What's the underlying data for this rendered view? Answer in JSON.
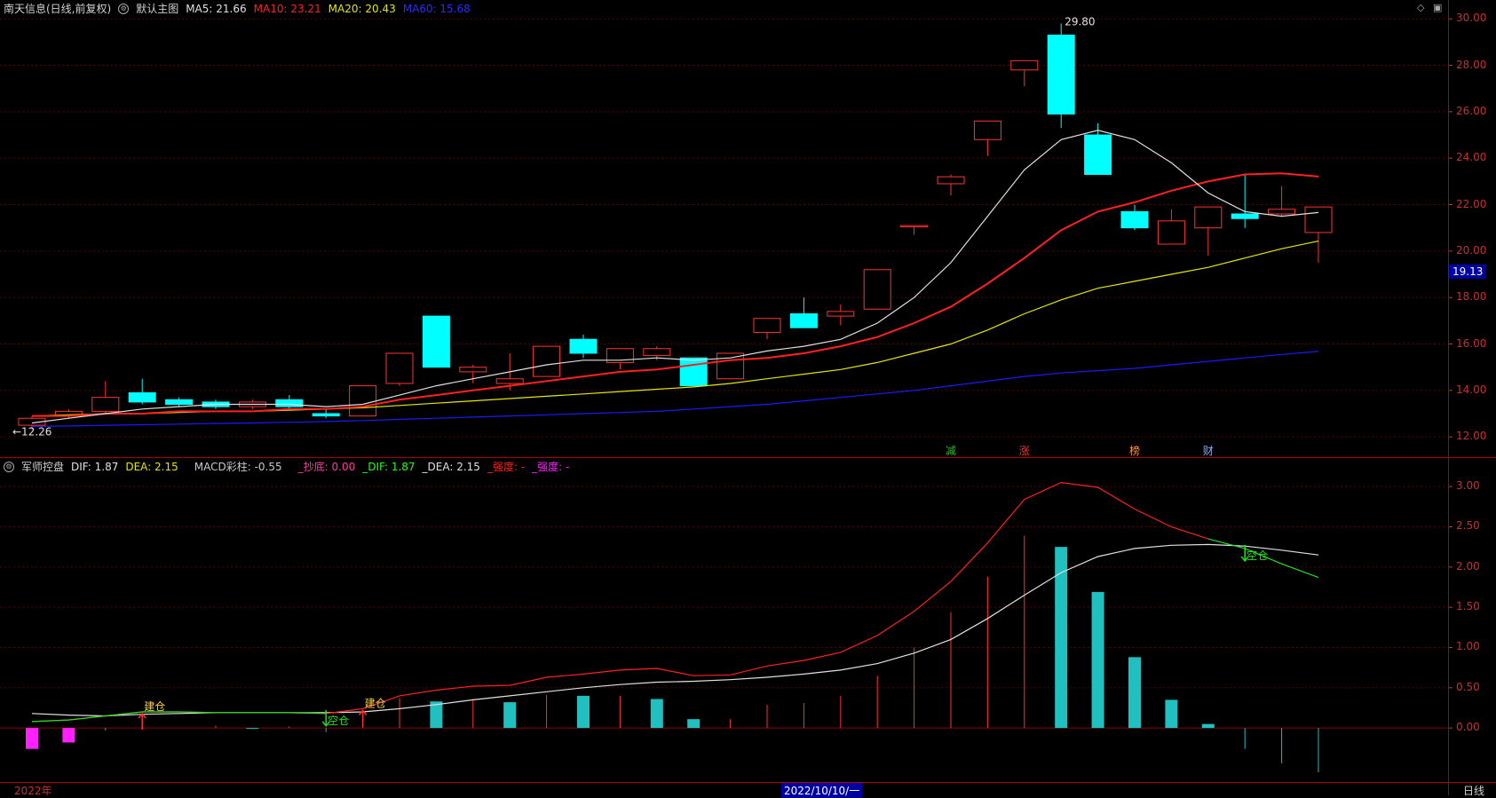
{
  "header": {
    "stock_title": "南天信息(日线,前复权)",
    "main_chart_label": "默认主图",
    "ma5": "MA5: 21.66",
    "ma10": "MA10: 23.21",
    "ma20": "MA20: 20.43",
    "ma60": "MA60: 15.68"
  },
  "sub_header": {
    "indicator_name": "军师控盘",
    "dif": "DIF: 1.87",
    "dea": "DEA: 2.15",
    "macd": "MACD彩柱: -0.55",
    "chaodi": "_抄底: 0.00",
    "dif2": "_DIF: 1.87",
    "dea2": "_DEA: 2.15",
    "qiangdu1": "_强度: -",
    "qiangdu2": "_强度: -"
  },
  "bottom": {
    "year_label": "2022年",
    "date_label": "2022/10/10/一",
    "period_label": "日线"
  },
  "price_tag": "19.13",
  "colors": {
    "up": "#ff3232",
    "down": "#00ffff",
    "ma5": "#e0e0e0",
    "ma10": "#ff2020",
    "ma20": "#e6e600",
    "ma60": "#1a1aff",
    "axis": "#c83030",
    "grid": "#5a0000"
  },
  "chart_data": [
    {
      "type": "candlestick",
      "ylim": [
        11.7,
        30.2
      ],
      "yticks": [
        12.0,
        14.0,
        16.0,
        18.0,
        20.0,
        22.0,
        24.0,
        26.0,
        28.0,
        30.0
      ],
      "ytick_labels": [
        "12.00",
        "14.00",
        "16.00",
        "18.00",
        "20.00",
        "22.00",
        "24.00",
        "26.00",
        "28.00",
        "30.00"
      ],
      "candles": [
        {
          "o": 12.5,
          "h": 12.9,
          "l": 12.3,
          "c": 12.8
        },
        {
          "o": 12.9,
          "h": 13.2,
          "l": 12.8,
          "c": 13.1
        },
        {
          "o": 13.1,
          "h": 14.4,
          "l": 13.0,
          "c": 13.7
        },
        {
          "o": 13.9,
          "h": 14.5,
          "l": 13.4,
          "c": 13.5
        },
        {
          "o": 13.6,
          "h": 13.7,
          "l": 13.3,
          "c": 13.4
        },
        {
          "o": 13.5,
          "h": 13.6,
          "l": 13.2,
          "c": 13.3
        },
        {
          "o": 13.3,
          "h": 13.6,
          "l": 13.2,
          "c": 13.5
        },
        {
          "o": 13.6,
          "h": 13.8,
          "l": 13.2,
          "c": 13.3
        },
        {
          "o": 13.0,
          "h": 13.2,
          "l": 12.8,
          "c": 12.9
        },
        {
          "o": 12.9,
          "h": 14.2,
          "l": 12.9,
          "c": 14.2
        },
        {
          "o": 14.3,
          "h": 15.6,
          "l": 14.2,
          "c": 15.6
        },
        {
          "o": 17.2,
          "h": 17.2,
          "l": 15.0,
          "c": 15.0
        },
        {
          "o": 14.8,
          "h": 15.1,
          "l": 14.3,
          "c": 15.0
        },
        {
          "o": 14.3,
          "h": 15.6,
          "l": 14.0,
          "c": 14.5
        },
        {
          "o": 14.6,
          "h": 15.9,
          "l": 14.6,
          "c": 15.9
        },
        {
          "o": 16.2,
          "h": 16.4,
          "l": 15.4,
          "c": 15.6
        },
        {
          "o": 15.2,
          "h": 15.8,
          "l": 14.9,
          "c": 15.8
        },
        {
          "o": 15.5,
          "h": 15.9,
          "l": 15.3,
          "c": 15.8
        },
        {
          "o": 15.4,
          "h": 15.4,
          "l": 14.2,
          "c": 14.2
        },
        {
          "o": 14.5,
          "h": 15.6,
          "l": 14.5,
          "c": 15.6
        },
        {
          "o": 16.5,
          "h": 17.1,
          "l": 16.2,
          "c": 17.1
        },
        {
          "o": 17.3,
          "h": 18.0,
          "l": 16.7,
          "c": 16.7
        },
        {
          "o": 17.2,
          "h": 17.7,
          "l": 16.8,
          "c": 17.4
        },
        {
          "o": 17.5,
          "h": 19.2,
          "l": 17.5,
          "c": 19.2
        },
        {
          "o": 21.1,
          "h": 21.1,
          "l": 20.7,
          "c": 21.1
        },
        {
          "o": 22.9,
          "h": 23.3,
          "l": 22.4,
          "c": 23.2
        },
        {
          "o": 24.8,
          "h": 25.6,
          "l": 24.1,
          "c": 25.6
        },
        {
          "o": 27.8,
          "h": 28.2,
          "l": 27.1,
          "c": 28.2
        },
        {
          "o": 29.3,
          "h": 29.8,
          "l": 25.3,
          "c": 25.9
        },
        {
          "o": 25.0,
          "h": 25.5,
          "l": 23.3,
          "c": 23.3
        },
        {
          "o": 21.7,
          "h": 22.0,
          "l": 20.9,
          "c": 21.0
        },
        {
          "o": 20.3,
          "h": 21.8,
          "l": 20.3,
          "c": 21.3
        },
        {
          "o": 21.0,
          "h": 21.9,
          "l": 19.8,
          "c": 21.9
        },
        {
          "o": 21.6,
          "h": 23.3,
          "l": 21.0,
          "c": 21.4
        },
        {
          "o": 21.6,
          "h": 22.8,
          "l": 21.5,
          "c": 21.8
        },
        {
          "o": 20.8,
          "h": 21.9,
          "l": 19.5,
          "c": 21.9
        }
      ],
      "ma5": [
        12.6,
        12.8,
        13.0,
        13.2,
        13.3,
        13.4,
        13.4,
        13.4,
        13.3,
        13.4,
        13.8,
        14.2,
        14.5,
        14.8,
        15.1,
        15.3,
        15.3,
        15.4,
        15.3,
        15.4,
        15.7,
        15.9,
        16.2,
        16.9,
        18.0,
        19.5,
        21.5,
        23.5,
        24.8,
        25.2,
        24.8,
        23.8,
        22.5,
        21.7,
        21.5,
        21.66
      ],
      "ma10": [
        12.9,
        12.9,
        13.0,
        13.0,
        13.1,
        13.1,
        13.1,
        13.2,
        13.2,
        13.3,
        13.6,
        13.8,
        14.0,
        14.2,
        14.4,
        14.6,
        14.8,
        14.9,
        15.1,
        15.3,
        15.4,
        15.6,
        15.9,
        16.3,
        16.9,
        17.6,
        18.6,
        19.7,
        20.9,
        21.7,
        22.1,
        22.6,
        23.0,
        23.3,
        23.35,
        23.21
      ],
      "ma20": [
        12.9,
        12.95,
        13.0,
        13.0,
        13.05,
        13.1,
        13.1,
        13.15,
        13.2,
        13.25,
        13.35,
        13.45,
        13.55,
        13.65,
        13.75,
        13.85,
        13.95,
        14.05,
        14.15,
        14.3,
        14.5,
        14.7,
        14.9,
        15.2,
        15.6,
        16.0,
        16.6,
        17.3,
        17.9,
        18.4,
        18.7,
        19.0,
        19.3,
        19.7,
        20.1,
        20.43
      ],
      "ma60": [
        12.45,
        12.47,
        12.5,
        12.52,
        12.55,
        12.58,
        12.6,
        12.63,
        12.66,
        12.7,
        12.75,
        12.8,
        12.85,
        12.9,
        12.95,
        13.0,
        13.05,
        13.1,
        13.2,
        13.3,
        13.4,
        13.55,
        13.7,
        13.85,
        14.0,
        14.2,
        14.4,
        14.6,
        14.75,
        14.85,
        14.95,
        15.1,
        15.25,
        15.4,
        15.55,
        15.68
      ],
      "annotations": [
        {
          "text": "29.80",
          "i": 28,
          "value": 29.8
        },
        {
          "text": "←12.26",
          "i": 0,
          "value": 12.26
        }
      ],
      "event_marks": [
        {
          "text": "减",
          "i": 25
        },
        {
          "text": "涨",
          "i": 27
        },
        {
          "text": "榜",
          "i": 30
        },
        {
          "text": "财",
          "i": 32
        }
      ]
    },
    {
      "type": "bar",
      "ylim": [
        -0.55,
        3.2
      ],
      "yticks": [
        0.0,
        0.5,
        1.0,
        1.5,
        2.0,
        2.5,
        3.0
      ],
      "ytick_labels": [
        "0.00",
        "0.50",
        "1.00",
        "1.50",
        "2.00",
        "2.50",
        "3.00"
      ],
      "macd_bars": [
        -0.26,
        -0.18,
        -0.03,
        0.0,
        0.0,
        0.03,
        0.0,
        0.02,
        -0.05,
        0.21,
        0.37,
        0.33,
        0.36,
        0.32,
        0.41,
        0.4,
        0.4,
        0.36,
        0.11,
        0.11,
        0.29,
        0.31,
        0.4,
        0.65,
        1.0,
        1.44,
        1.88,
        2.39,
        2.25,
        1.69,
        0.88,
        0.35,
        0.05,
        -0.26,
        -0.44,
        -0.55
      ],
      "dif": [
        0.08,
        0.1,
        0.15,
        0.2,
        0.2,
        0.19,
        0.19,
        0.19,
        0.18,
        0.24,
        0.4,
        0.47,
        0.52,
        0.53,
        0.63,
        0.67,
        0.72,
        0.74,
        0.65,
        0.66,
        0.77,
        0.84,
        0.94,
        1.15,
        1.45,
        1.82,
        2.3,
        2.84,
        3.05,
        2.99,
        2.72,
        2.5,
        2.35,
        2.23,
        2.04,
        1.87
      ],
      "dea": [
        0.18,
        0.16,
        0.15,
        0.17,
        0.18,
        0.19,
        0.19,
        0.19,
        0.19,
        0.2,
        0.24,
        0.29,
        0.35,
        0.4,
        0.45,
        0.5,
        0.54,
        0.57,
        0.58,
        0.6,
        0.63,
        0.67,
        0.72,
        0.8,
        0.93,
        1.1,
        1.36,
        1.65,
        1.93,
        2.13,
        2.23,
        2.27,
        2.28,
        2.26,
        2.21,
        2.15
      ],
      "signals": [
        {
          "text": "建仓",
          "i": 3,
          "value": 0.2,
          "kind": "up"
        },
        {
          "text": "空仓",
          "i": 8,
          "value": 0.18,
          "kind": "down"
        },
        {
          "text": "建仓",
          "i": 9,
          "value": 0.24,
          "kind": "up"
        },
        {
          "text": "空仓",
          "i": 33,
          "value": 2.23,
          "kind": "down"
        }
      ]
    }
  ]
}
